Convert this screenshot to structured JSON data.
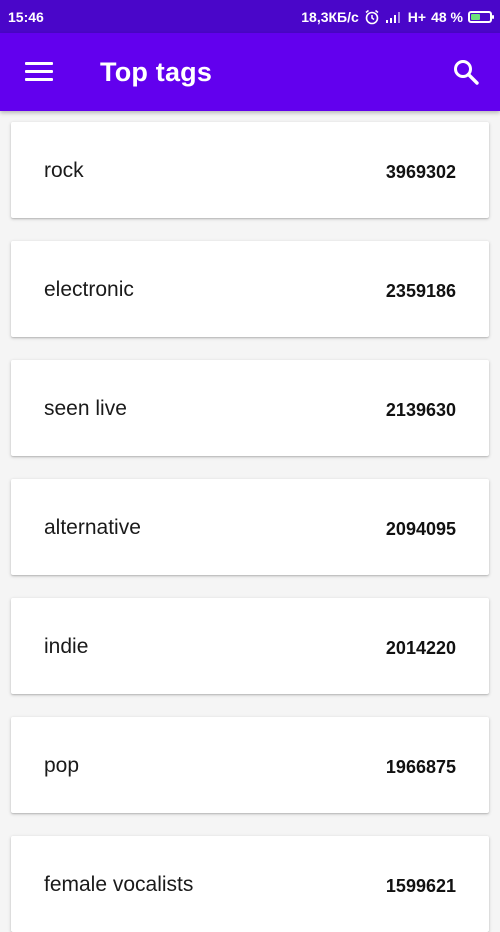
{
  "status_bar": {
    "time": "15:46",
    "network_speed": "18,3КБ/с",
    "network_type": "H+",
    "battery_level": "48 %",
    "battery_fraction": 0.48,
    "icons": [
      "alarm-icon",
      "signal-icon",
      "battery-charging-icon"
    ]
  },
  "app_bar": {
    "title": "Top tags",
    "menu_icon": "menu-icon",
    "search_icon": "search-icon"
  },
  "colors": {
    "app_bar": "#6200ee",
    "status_bar": "#4a06c9",
    "background": "#f5f5f5",
    "card": "#ffffff"
  },
  "tags": [
    {
      "name": "rock",
      "count": "3969302"
    },
    {
      "name": "electronic",
      "count": "2359186"
    },
    {
      "name": "seen live",
      "count": "2139630"
    },
    {
      "name": "alternative",
      "count": "2094095"
    },
    {
      "name": "indie",
      "count": "2014220"
    },
    {
      "name": "pop",
      "count": "1966875"
    },
    {
      "name": "female vocalists",
      "count": "1599621"
    }
  ]
}
